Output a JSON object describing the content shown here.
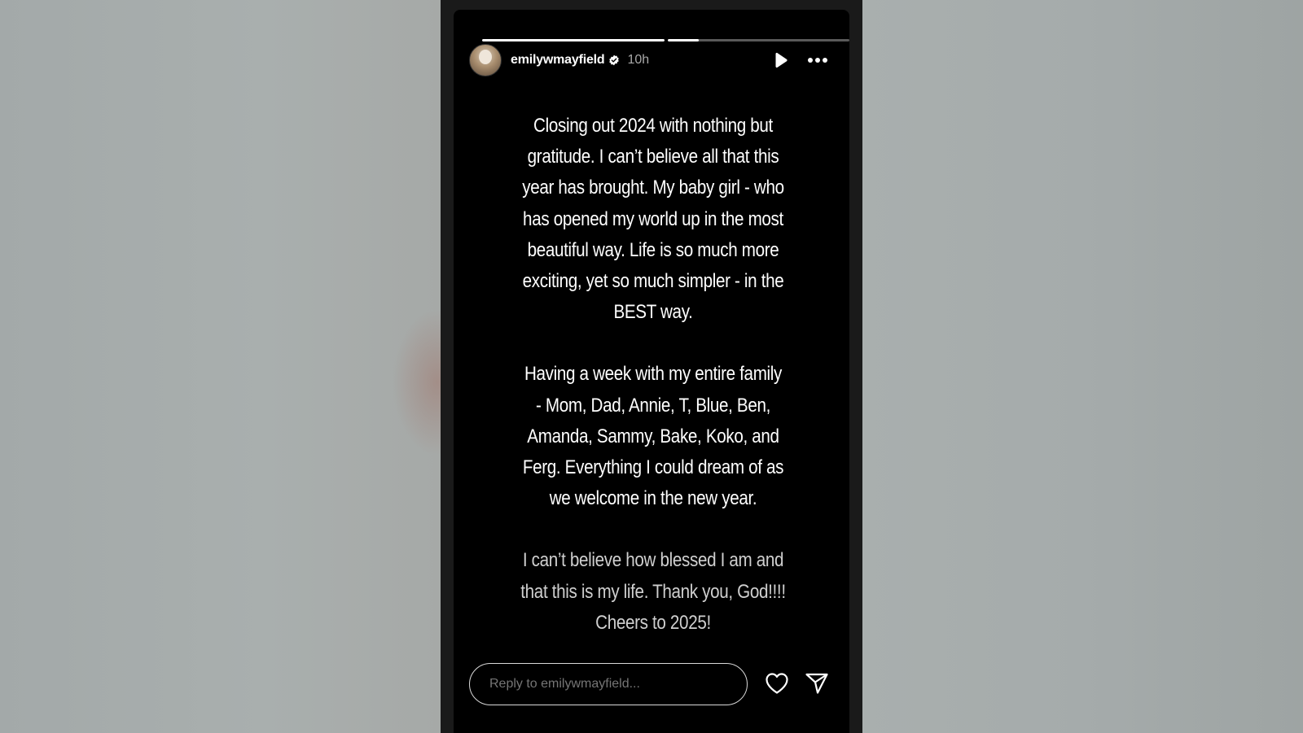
{
  "story": {
    "username": "emilywmayfield",
    "verified": true,
    "timestamp": "10h",
    "progress": {
      "segment_count": 2,
      "current_segment": 2,
      "current_segment_progress": 0.17
    },
    "paragraphs": [
      "Closing out 2024 with nothing but gratitude. I can’t believe all that this year has brought. My baby girl - who has opened my world up in the most beautiful way. Life is so much more exciting, yet so much simpler - in the BEST way.",
      "Having a week with my entire family - Mom, Dad, Annie, T, Blue, Ben, Amanda, Sammy, Bake, Koko, and Ferg. Everything I could dream of as we welcome in the new year.",
      "I can’t believe how blessed I am and that this is my life. Thank you, God!!!! Cheers to 2025!"
    ]
  },
  "reply": {
    "placeholder": "Reply to emilywmayfield..."
  },
  "icons": {
    "avatar": "avatar",
    "verified": "verified-badge-icon",
    "play": "play-icon",
    "more": "more-options-icon",
    "heart": "heart-icon",
    "send": "send-icon"
  }
}
